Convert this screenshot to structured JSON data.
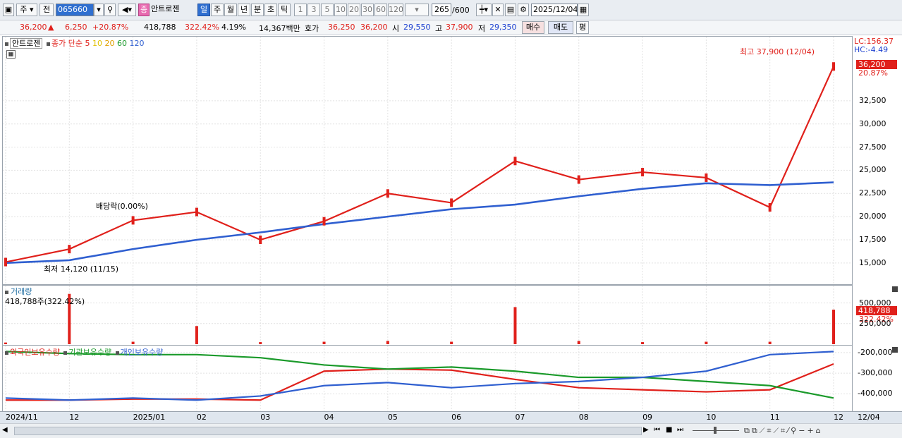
{
  "toolbar": {
    "type_label": "주",
    "mode_label": "전",
    "code_value": "065660",
    "stock_badge": "종",
    "stock_name": "안트로젠",
    "periods": [
      "일",
      "주",
      "월",
      "년",
      "분",
      "초",
      "틱"
    ],
    "minutes": [
      "1",
      "3",
      "5",
      "10",
      "20",
      "30",
      "60",
      "120"
    ],
    "count_value": "265",
    "count_max": "/600",
    "date_value": "2025/12/04"
  },
  "quote": {
    "price": "36,200",
    "up_arrow": "▲",
    "change": "6,250",
    "change_pct": "+20.87%",
    "volume": "418,788",
    "volume_pct": "322.42%",
    "turnover": "4.19%",
    "amount": "14,367백만",
    "bid_label": "호가",
    "bid1": "36,250",
    "bid2": "36,200",
    "open_label": "시",
    "open": "29,550",
    "high_label": "고",
    "high": "37,900",
    "low_label": "저",
    "low": "29,350",
    "buy_label": "매수",
    "sell_label": "매도",
    "avg_label": "평"
  },
  "price_panel": {
    "stock_tag": "안트로젠",
    "ma_title": "종가 단순",
    "ma_periods": [
      "5",
      "10",
      "20",
      "60",
      "120"
    ],
    "ma_colors": [
      "#e0201b",
      "#f2c400",
      "#e0a000",
      "#1a9a2a",
      "#2f5fd0"
    ],
    "lc_label": "LC:156.37",
    "hc_label": "HC:-4.49",
    "last_price_box": "36,200",
    "last_pct": "20.87%",
    "high_note": "최고 37,900 (12/04)",
    "low_note": "최저 14,120 (11/15)",
    "dividend_note": "배당락(0.00%)",
    "yticks": [
      "32,500",
      "30,000",
      "27,500",
      "25,000",
      "22,500",
      "20,000",
      "17,500",
      "15,000"
    ]
  },
  "volume_panel": {
    "title": "거래량",
    "value": "418,788주(322.42%)",
    "box": "418,788",
    "pct": "322.42%",
    "yticks": [
      "500,000",
      "250,000"
    ]
  },
  "holding_panel": {
    "legend": [
      "외국인보유수량",
      "기관보유수량",
      "개인보유수량"
    ],
    "colors": [
      "#e0201b",
      "#1a9a2a",
      "#2f5fd0"
    ],
    "yticks": [
      "-200,000",
      "-300,000",
      "-400,000"
    ]
  },
  "x_axis": {
    "labels": [
      "2024/11",
      "12",
      "2025/01",
      "02",
      "03",
      "04",
      "05",
      "06",
      "07",
      "08",
      "09",
      "10",
      "11",
      "12"
    ],
    "right_label": "12/04"
  },
  "chart_data": [
    {
      "type": "line",
      "title": "",
      "x": [
        "2024/11",
        "2024/12",
        "2025/01",
        "2025/02",
        "2025/03",
        "2025/04",
        "2025/05",
        "2025/06",
        "2025/07",
        "2025/08",
        "2025/09",
        "2025/10",
        "2025/11",
        "2025/12/04"
      ],
      "series": [
        {
          "name": "5",
          "values": [
            15100,
            16500,
            19600,
            20500,
            17500,
            19500,
            22500,
            21500,
            26000,
            24000,
            24800,
            24200,
            21000,
            36200
          ]
        },
        {
          "name": "120",
          "values": [
            15000,
            15300,
            16500,
            17500,
            18300,
            19200,
            20000,
            20800,
            21300,
            22200,
            23000,
            23600,
            23400,
            23700
          ]
        }
      ],
      "ylim": [
        14000,
        38500
      ]
    },
    {
      "type": "bar",
      "title": "거래량",
      "x": [
        "2024/11",
        "2024/12",
        "2025/01",
        "2025/02",
        "2025/03",
        "2025/04",
        "2025/05",
        "2025/06",
        "2025/07",
        "2025/08",
        "2025/09",
        "2025/10",
        "2025/11",
        "2025/12/04"
      ],
      "values": [
        20000,
        610000,
        30000,
        220000,
        25000,
        30000,
        40000,
        30000,
        450000,
        40000,
        25000,
        30000,
        30000,
        418788
      ],
      "ylim": [
        0,
        650000
      ]
    },
    {
      "type": "line",
      "x": [
        "2024/11",
        "2024/12",
        "2025/01",
        "2025/02",
        "2025/03",
        "2025/04",
        "2025/05",
        "2025/06",
        "2025/07",
        "2025/08",
        "2025/09",
        "2025/10",
        "2025/11",
        "2025/12/04"
      ],
      "series": [
        {
          "name": "외국인보유수량",
          "values": [
            -430000,
            -430000,
            -425000,
            -425000,
            -430000,
            -290000,
            -280000,
            -285000,
            -330000,
            -370000,
            -380000,
            -390000,
            -380000,
            -255000
          ]
        },
        {
          "name": "기관보유수량",
          "values": [
            -195000,
            -205000,
            -210000,
            -210000,
            -225000,
            -260000,
            -280000,
            -270000,
            -290000,
            -320000,
            -320000,
            -340000,
            -360000,
            -420000
          ]
        },
        {
          "name": "개인보유수량",
          "values": [
            -420000,
            -430000,
            -420000,
            -430000,
            -410000,
            -360000,
            -345000,
            -370000,
            -350000,
            -340000,
            -320000,
            -290000,
            -210000,
            -195000
          ]
        }
      ],
      "ylim": [
        -470000,
        -180000
      ]
    }
  ]
}
